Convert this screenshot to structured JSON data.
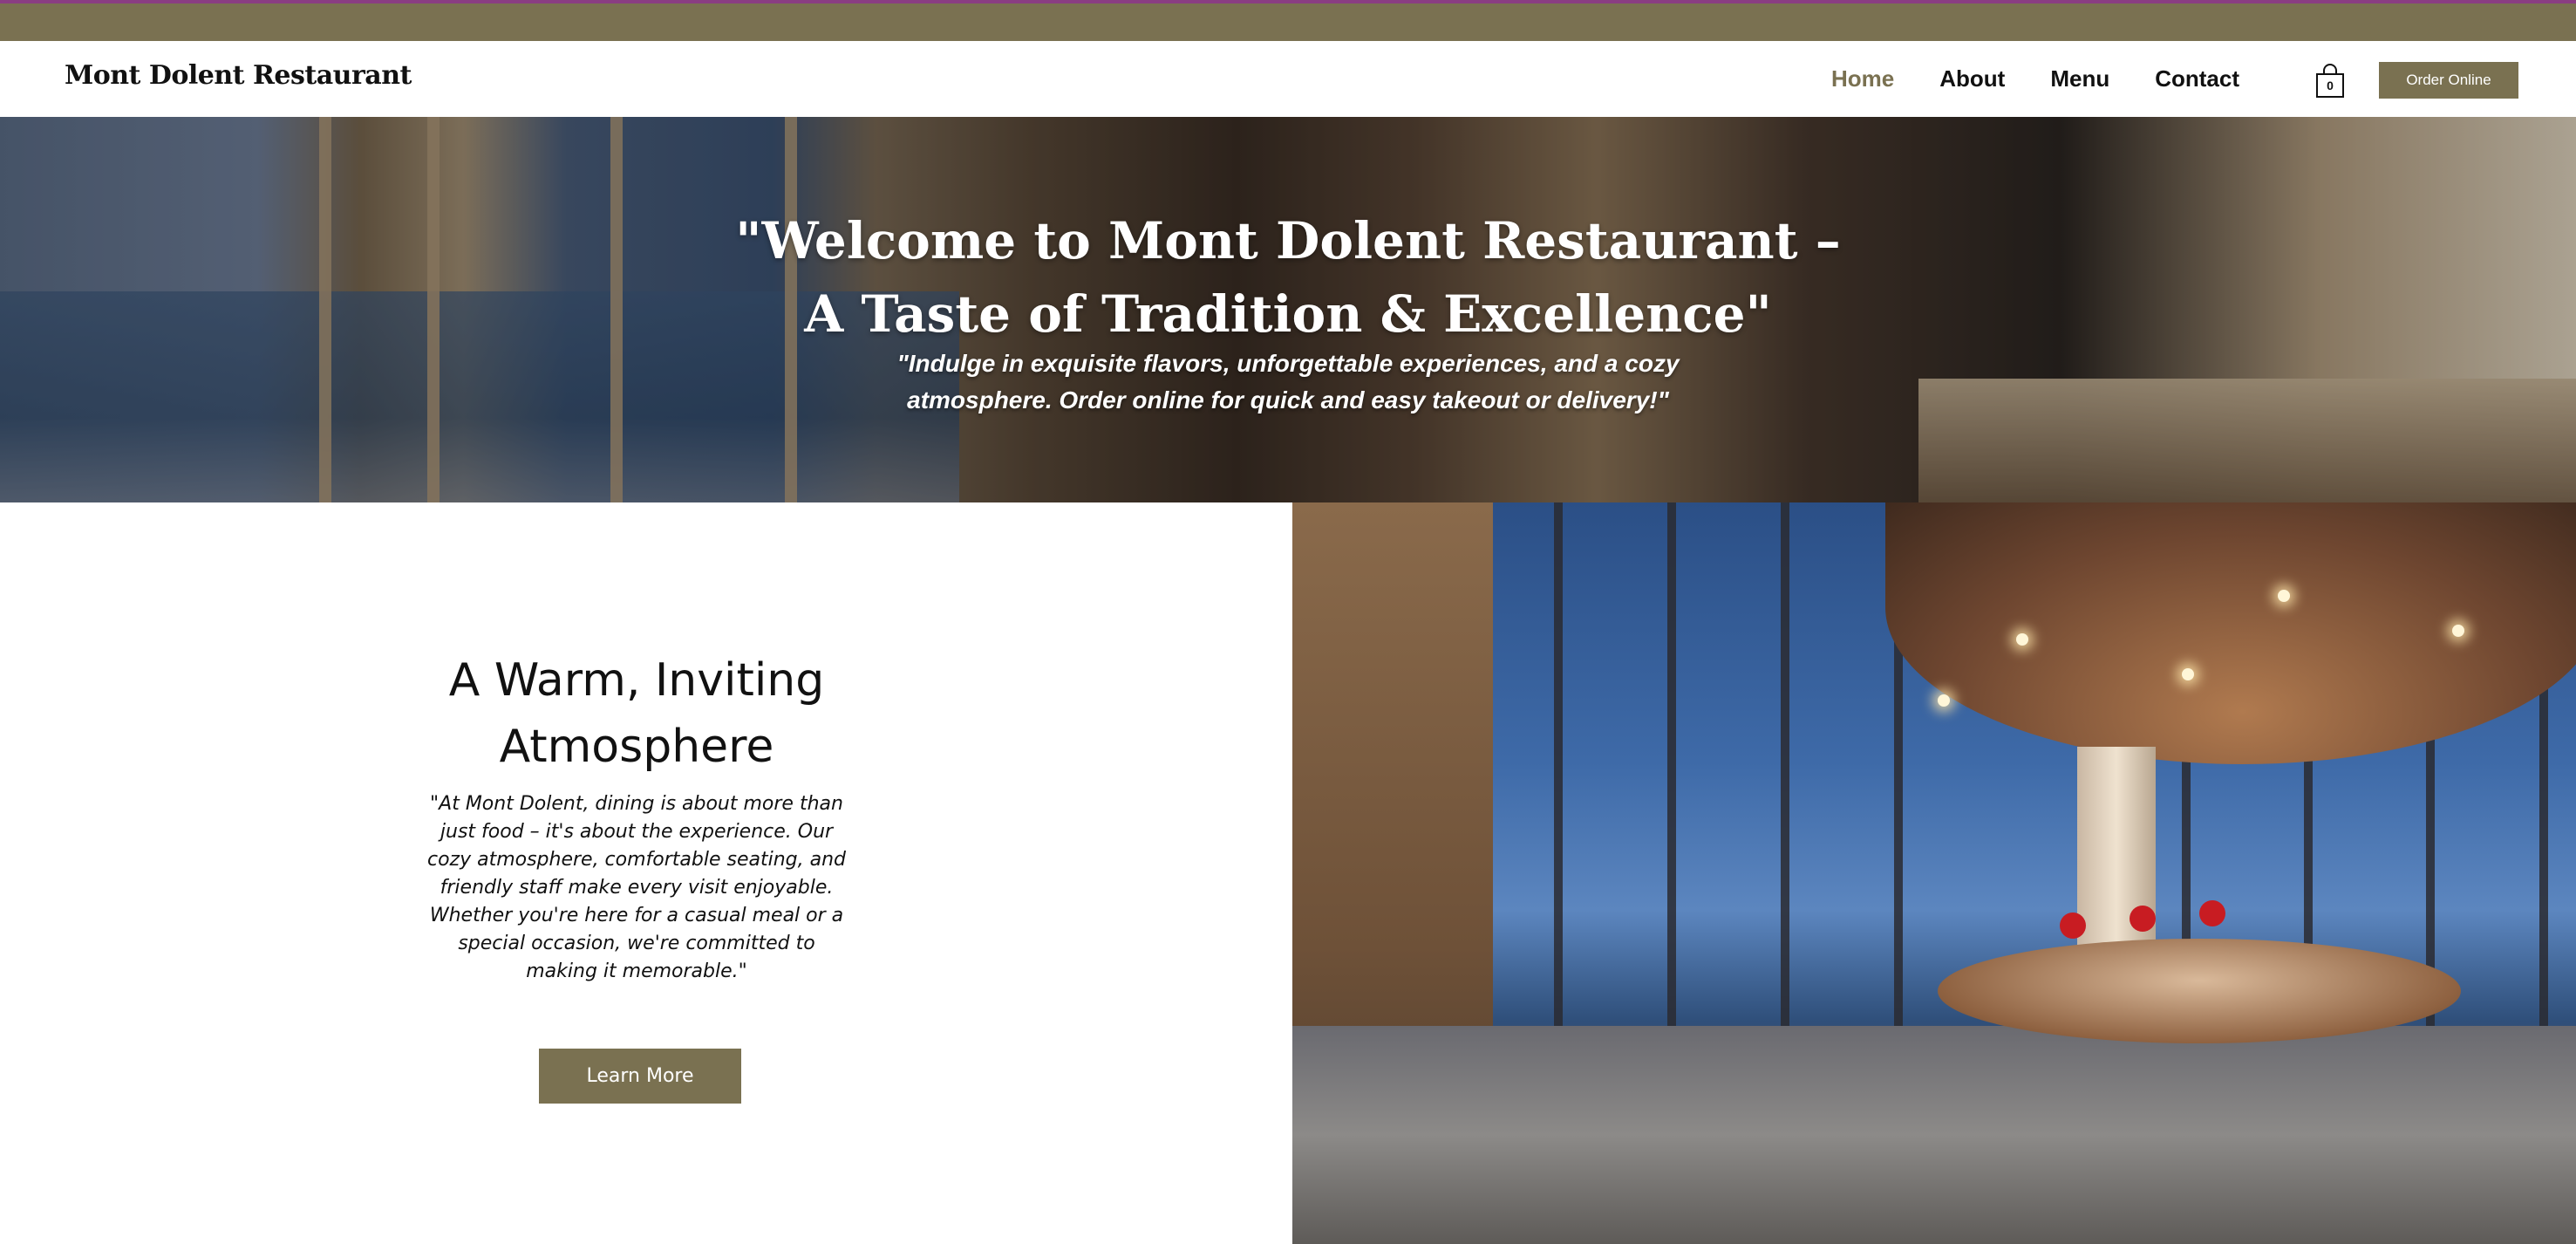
{
  "brand": {
    "name": "Mont Dolent Restaurant"
  },
  "nav": {
    "items": [
      {
        "label": "Home",
        "active": true
      },
      {
        "label": "About",
        "active": false
      },
      {
        "label": "Menu",
        "active": false
      },
      {
        "label": "Contact",
        "active": false
      }
    ]
  },
  "cart": {
    "count": "0",
    "icon": "shopping-bag-icon"
  },
  "order_button": {
    "label": "Order Online"
  },
  "hero": {
    "title_line1": "\"Welcome to Mont Dolent Restaurant –",
    "title_line2": "A Taste of Tradition & Excellence\"",
    "subtitle_line1": "\"Indulge in exquisite flavors, unforgettable experiences, and a cozy",
    "subtitle_line2": "atmosphere. Order online for quick and easy takeout or delivery!\""
  },
  "about": {
    "title_line1": "A Warm, Inviting",
    "title_line2": "Atmosphere",
    "text_lines": [
      "\"At Mont Dolent, dining is about more than",
      "just food – it's about the experience. Our",
      "cozy atmosphere, comfortable seating, and",
      "friendly staff make every visit enjoyable.",
      "Whether you're here for a casual meal or a",
      "special occasion, we're committed to",
      "making it memorable.\""
    ],
    "button_label": "Learn More"
  },
  "colors": {
    "accent": "#7a7151",
    "topbar_border": "#8a3d82",
    "nav_active": "#7a7151"
  }
}
